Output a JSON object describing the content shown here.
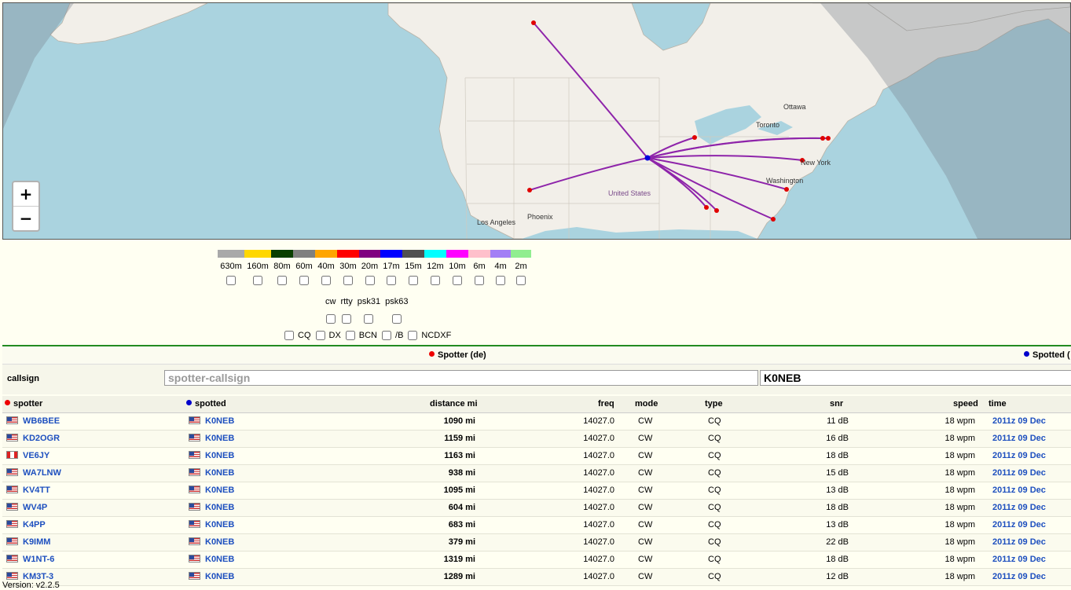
{
  "map": {
    "labels": {
      "ottawa": "Ottawa",
      "toronto": "Toronto",
      "new_york": "New York",
      "washington": "Washington",
      "united_states": "United States",
      "phoenix": "Phoenix",
      "los_angeles": "Los Angeles"
    },
    "zoom_in": "+",
    "zoom_out": "−",
    "land_color": "#f2efe9",
    "water_color": "#aad3df",
    "path_color": "#8e24aa"
  },
  "bands": [
    {
      "label": "630m",
      "color": "#a9a9a9"
    },
    {
      "label": "160m",
      "color": "#ffd700"
    },
    {
      "label": "80m",
      "color": "#093f00"
    },
    {
      "label": "60m",
      "color": "#808080"
    },
    {
      "label": "40m",
      "color": "#ffa500"
    },
    {
      "label": "30m",
      "color": "#ff0000"
    },
    {
      "label": "20m",
      "color": "#800080"
    },
    {
      "label": "17m",
      "color": "#0000ff"
    },
    {
      "label": "15m",
      "color": "#505050"
    },
    {
      "label": "12m",
      "color": "#00ffff"
    },
    {
      "label": "10m",
      "color": "#ff00ff"
    },
    {
      "label": "6m",
      "color": "#ffc0cb"
    },
    {
      "label": "4m",
      "color": "#a37ff5"
    },
    {
      "label": "2m",
      "color": "#90ee90"
    }
  ],
  "modes": [
    "cw",
    "rtty",
    "psk31",
    "psk63"
  ],
  "types": [
    "CQ",
    "DX",
    "BCN",
    "/B",
    "NCDXF"
  ],
  "filter": {
    "spotter_header": "Spotter (de)",
    "spotted_header": "Spotted (",
    "callsign_label": "callsign",
    "spotter_placeholder": "spotter-callsign",
    "spotted_value": "K0NEB"
  },
  "table": {
    "headers": {
      "spotter": "spotter",
      "spotted": "spotted",
      "distance": "distance mi",
      "freq": "freq",
      "mode": "mode",
      "type": "type",
      "snr": "snr",
      "speed": "speed",
      "time": "time"
    },
    "rows": [
      {
        "spotter": "WB6BEE",
        "sflag": "us",
        "spotted": "K0NEB",
        "distance": "1090 mi",
        "freq": "14027.0",
        "mode": "CW",
        "type": "CQ",
        "snr": "11 dB",
        "speed": "18 wpm",
        "time": "2011z 09 Dec"
      },
      {
        "spotter": "KD2OGR",
        "sflag": "us",
        "spotted": "K0NEB",
        "distance": "1159 mi",
        "freq": "14027.0",
        "mode": "CW",
        "type": "CQ",
        "snr": "16 dB",
        "speed": "18 wpm",
        "time": "2011z 09 Dec"
      },
      {
        "spotter": "VE6JY",
        "sflag": "ca",
        "spotted": "K0NEB",
        "distance": "1163 mi",
        "freq": "14027.0",
        "mode": "CW",
        "type": "CQ",
        "snr": "18 dB",
        "speed": "18 wpm",
        "time": "2011z 09 Dec"
      },
      {
        "spotter": "WA7LNW",
        "sflag": "us",
        "spotted": "K0NEB",
        "distance": "938 mi",
        "freq": "14027.0",
        "mode": "CW",
        "type": "CQ",
        "snr": "15 dB",
        "speed": "18 wpm",
        "time": "2011z 09 Dec"
      },
      {
        "spotter": "KV4TT",
        "sflag": "us",
        "spotted": "K0NEB",
        "distance": "1095 mi",
        "freq": "14027.0",
        "mode": "CW",
        "type": "CQ",
        "snr": "13 dB",
        "speed": "18 wpm",
        "time": "2011z 09 Dec"
      },
      {
        "spotter": "WV4P",
        "sflag": "us",
        "spotted": "K0NEB",
        "distance": "604 mi",
        "freq": "14027.0",
        "mode": "CW",
        "type": "CQ",
        "snr": "18 dB",
        "speed": "18 wpm",
        "time": "2011z 09 Dec"
      },
      {
        "spotter": "K4PP",
        "sflag": "us",
        "spotted": "K0NEB",
        "distance": "683 mi",
        "freq": "14027.0",
        "mode": "CW",
        "type": "CQ",
        "snr": "13 dB",
        "speed": "18 wpm",
        "time": "2011z 09 Dec"
      },
      {
        "spotter": "K9IMM",
        "sflag": "us",
        "spotted": "K0NEB",
        "distance": "379 mi",
        "freq": "14027.0",
        "mode": "CW",
        "type": "CQ",
        "snr": "22 dB",
        "speed": "18 wpm",
        "time": "2011z 09 Dec"
      },
      {
        "spotter": "W1NT-6",
        "sflag": "us",
        "spotted": "K0NEB",
        "distance": "1319 mi",
        "freq": "14027.0",
        "mode": "CW",
        "type": "CQ",
        "snr": "18 dB",
        "speed": "18 wpm",
        "time": "2011z 09 Dec"
      },
      {
        "spotter": "KM3T-3",
        "sflag": "us",
        "spotted": "K0NEB",
        "distance": "1289 mi",
        "freq": "14027.0",
        "mode": "CW",
        "type": "CQ",
        "snr": "12 dB",
        "speed": "18 wpm",
        "time": "2011z 09 Dec"
      }
    ]
  },
  "version": "Version: v2.2.5"
}
